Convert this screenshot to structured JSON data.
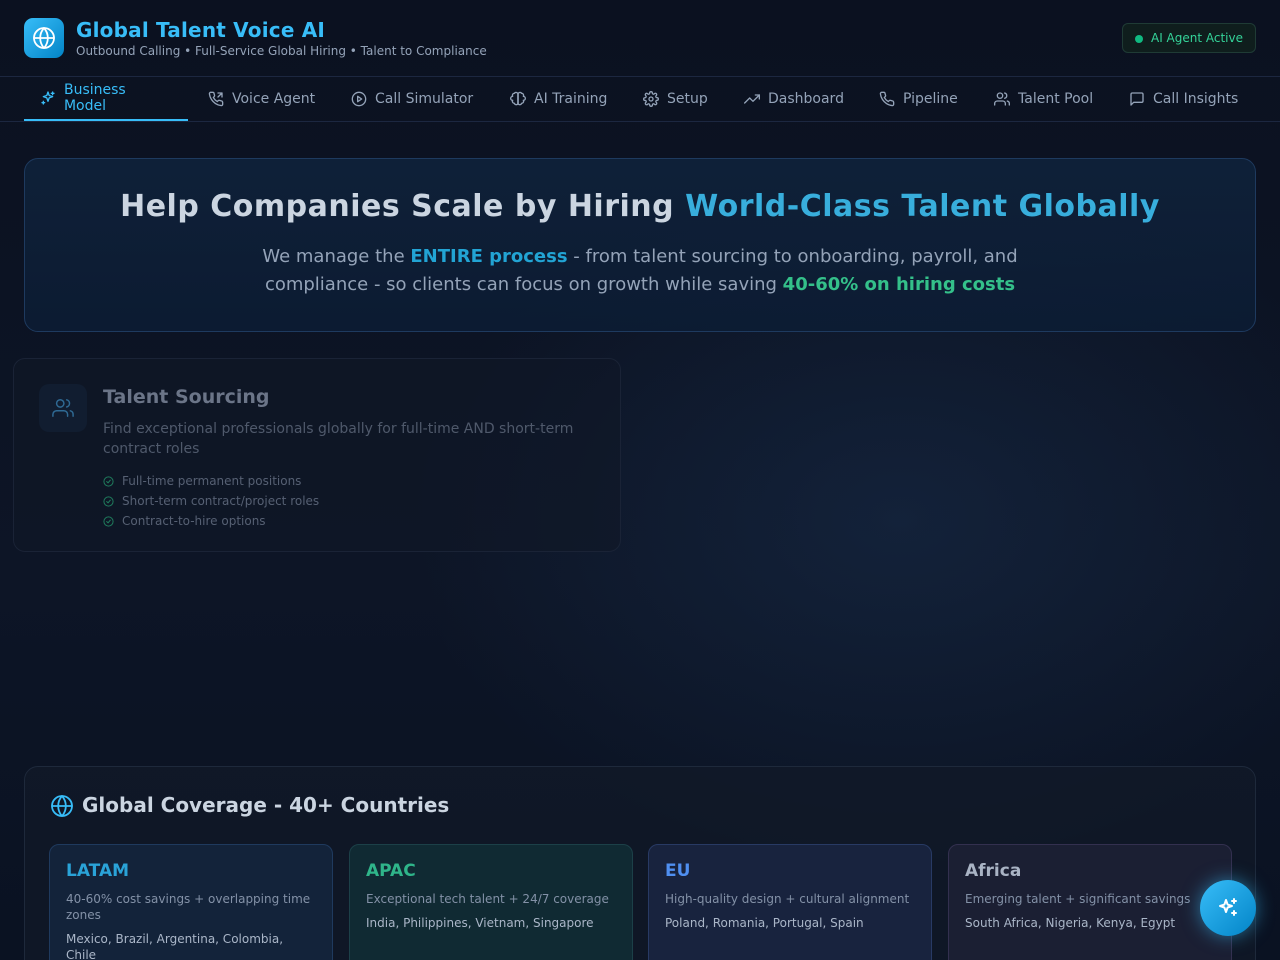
{
  "header": {
    "title": "Global Talent Voice AI",
    "subtitle": "Outbound Calling • Full-Service Global Hiring • Talent to Compliance",
    "status": "AI Agent Active"
  },
  "nav": {
    "tabs": [
      {
        "label": "Business Model",
        "icon": "sparkles-icon",
        "active": true
      },
      {
        "label": "Voice Agent",
        "icon": "phone-outgoing-icon"
      },
      {
        "label": "Call Simulator",
        "icon": "play-circle-icon"
      },
      {
        "label": "AI Training",
        "icon": "brain-icon"
      },
      {
        "label": "Setup",
        "icon": "gear-icon"
      },
      {
        "label": "Dashboard",
        "icon": "trending-up-icon"
      },
      {
        "label": "Pipeline",
        "icon": "phone-icon"
      },
      {
        "label": "Talent Pool",
        "icon": "users-icon"
      },
      {
        "label": "Call Insights",
        "icon": "message-square-icon"
      }
    ]
  },
  "hero": {
    "title_start": "Help Companies Scale by Hiring ",
    "title_highlight": "World-Class Talent Globally",
    "desc_1": "We manage the ",
    "desc_bold_1": "ENTIRE process",
    "desc_2": " - from talent sourcing to onboarding, payroll, and compliance - so clients can focus on growth while saving ",
    "desc_bold_2": "40-60% on hiring costs"
  },
  "service_card": {
    "title": "Talent Sourcing",
    "description": "Find exceptional professionals globally for full-time AND short-term contract roles",
    "features": [
      "Full-time permanent positions",
      "Short-term contract/project roles",
      "Contract-to-hire options"
    ]
  },
  "coverage": {
    "title": "Global Coverage - 40+ Countries",
    "regions": [
      {
        "name": "LATAM",
        "color": "#2aa3d8",
        "desc": "40-60% cost savings + overlapping time zones",
        "countries": "Mexico, Brazil, Argentina, Colombia, Chile"
      },
      {
        "name": "APAC",
        "color": "#2fb58a",
        "desc": "Exceptional tech talent + 24/7 coverage",
        "countries": "India, Philippines, Vietnam, Singapore"
      },
      {
        "name": "EU",
        "color": "#4f8ff0",
        "desc": "High-quality design + cultural alignment",
        "countries": "Poland, Romania, Portugal, Spain"
      },
      {
        "name": "Africa",
        "color": "#a9b3c4",
        "desc": "Emerging talent + significant savings",
        "countries": "South Africa, Nigeria, Kenya, Egypt"
      }
    ]
  },
  "colors": {
    "accent": "#38bdf8",
    "success": "#34d399",
    "background": "#0b1120"
  }
}
